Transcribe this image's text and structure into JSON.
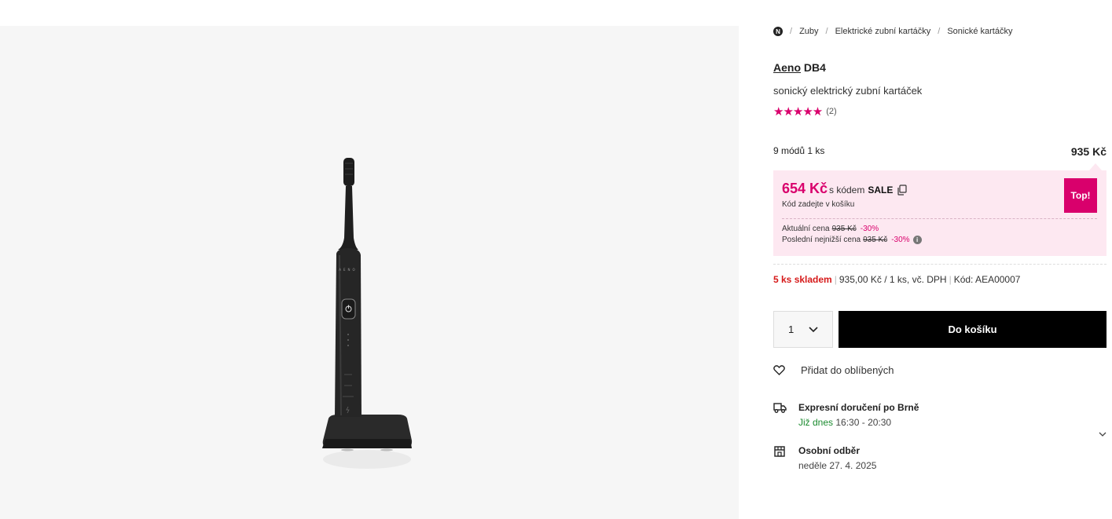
{
  "breadcrumb": {
    "home_icon_letter": "N",
    "items": [
      "Zuby",
      "Elektrické zubní kartáčky",
      "Sonické kartáčky"
    ]
  },
  "product": {
    "brand": "Aeno",
    "model": "DB4",
    "subtitle": "sonický elektrický zubní kartáček",
    "rating_stars": "★★★★★",
    "rating_value": 5,
    "rating_count": "(2)",
    "image_logo_text": "AENO"
  },
  "variant": {
    "label": "9 módů 1 ks",
    "price": "935 Kč"
  },
  "promo": {
    "price": "654 Kč",
    "code_prefix": "s kódem",
    "code": "SALE",
    "note": "Kód zadejte v košíku",
    "badge": "Top!",
    "current_label": "Aktuální cena",
    "current_old": "935 Kč",
    "current_discount": "-30%",
    "lowest_label": "Poslední nejnižší cena",
    "lowest_old": "935 Kč",
    "lowest_discount": "-30%",
    "info_symbol": "i"
  },
  "stock": {
    "status": "5 ks skladem",
    "unit_price": "935,00 Kč / 1 ks, vč. DPH",
    "code": "Kód: AEA00007"
  },
  "cart": {
    "quantity": "1",
    "button_label": "Do košíku"
  },
  "favorite": {
    "label": "Přidat do oblíbených"
  },
  "delivery": [
    {
      "title": "Expresní doručení po Brně",
      "highlight": "Již dnes",
      "time": "16:30 - 20:30"
    },
    {
      "title": "Osobní odběr",
      "date": "neděle 27. 4. 2025"
    }
  ],
  "colors": {
    "accent": "#d9006c",
    "promo_bg": "#fde8f1",
    "stock_red": "#d61a1a",
    "delivery_green": "#1a8a2e"
  }
}
